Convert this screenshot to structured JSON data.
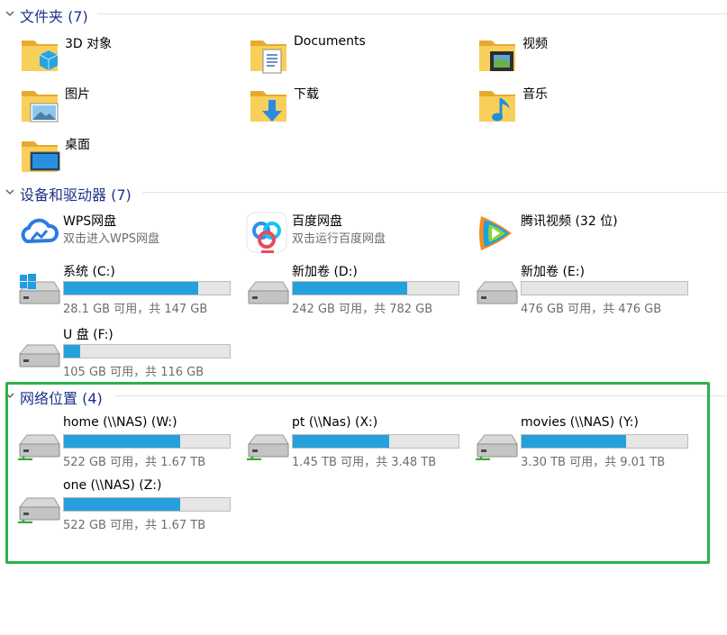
{
  "groups": {
    "folders": {
      "title": "文件夹 (7)"
    },
    "devices": {
      "title": "设备和驱动器 (7)"
    },
    "network": {
      "title": "网络位置 (4)"
    }
  },
  "folders": [
    {
      "name": "3D 对象",
      "icon": "folder-3d-objects-icon"
    },
    {
      "name": "Documents",
      "icon": "folder-documents-icon"
    },
    {
      "name": "视频",
      "icon": "folder-videos-icon"
    },
    {
      "name": "图片",
      "icon": "folder-pictures-icon"
    },
    {
      "name": "下载",
      "icon": "folder-downloads-icon"
    },
    {
      "name": "音乐",
      "icon": "folder-music-icon"
    },
    {
      "name": "桌面",
      "icon": "folder-desktop-icon"
    }
  ],
  "apps": [
    {
      "name": "WPS网盘",
      "sub": "双击进入WPS网盘",
      "icon": "wps-cloud-icon"
    },
    {
      "name": "百度网盘",
      "sub": "双击运行百度网盘",
      "icon": "baidu-netdisk-icon"
    },
    {
      "name": "腾讯视频 (32 位)",
      "sub": "",
      "icon": "tencent-video-icon"
    }
  ],
  "drives": [
    {
      "name": "系统 (C:)",
      "sub": "28.1 GB 可用，共 147 GB",
      "used_fraction": 0.81,
      "icon": "windows-drive-icon"
    },
    {
      "name": "新加卷 (D:)",
      "sub": "242 GB 可用，共 782 GB",
      "used_fraction": 0.69,
      "icon": "hard-drive-icon"
    },
    {
      "name": "新加卷 (E:)",
      "sub": "476 GB 可用，共 476 GB",
      "used_fraction": 0.0,
      "icon": "hard-drive-icon"
    },
    {
      "name": "U 盘 (F:)",
      "sub": "105 GB 可用，共 116 GB",
      "used_fraction": 0.1,
      "icon": "usb-drive-icon"
    }
  ],
  "network": [
    {
      "name": "home (\\\\NAS) (W:)",
      "sub": "522 GB 可用，共 1.67 TB",
      "used_fraction": 0.7,
      "icon": "network-drive-icon"
    },
    {
      "name": "pt (\\\\Nas) (X:)",
      "sub": "1.45 TB 可用，共 3.48 TB",
      "used_fraction": 0.58,
      "icon": "network-drive-icon"
    },
    {
      "name": "movies (\\\\NAS) (Y:)",
      "sub": "3.30 TB 可用，共 9.01 TB",
      "used_fraction": 0.63,
      "icon": "network-drive-icon"
    },
    {
      "name": "one (\\\\NAS) (Z:)",
      "sub": "522 GB 可用，共 1.67 TB",
      "used_fraction": 0.7,
      "icon": "network-drive-icon"
    }
  ],
  "colors": {
    "group_title": "#1e3287",
    "capacity_fill": "#26a0da",
    "highlight_border": "#2db14a",
    "folder_yellow": "#f5c342"
  }
}
